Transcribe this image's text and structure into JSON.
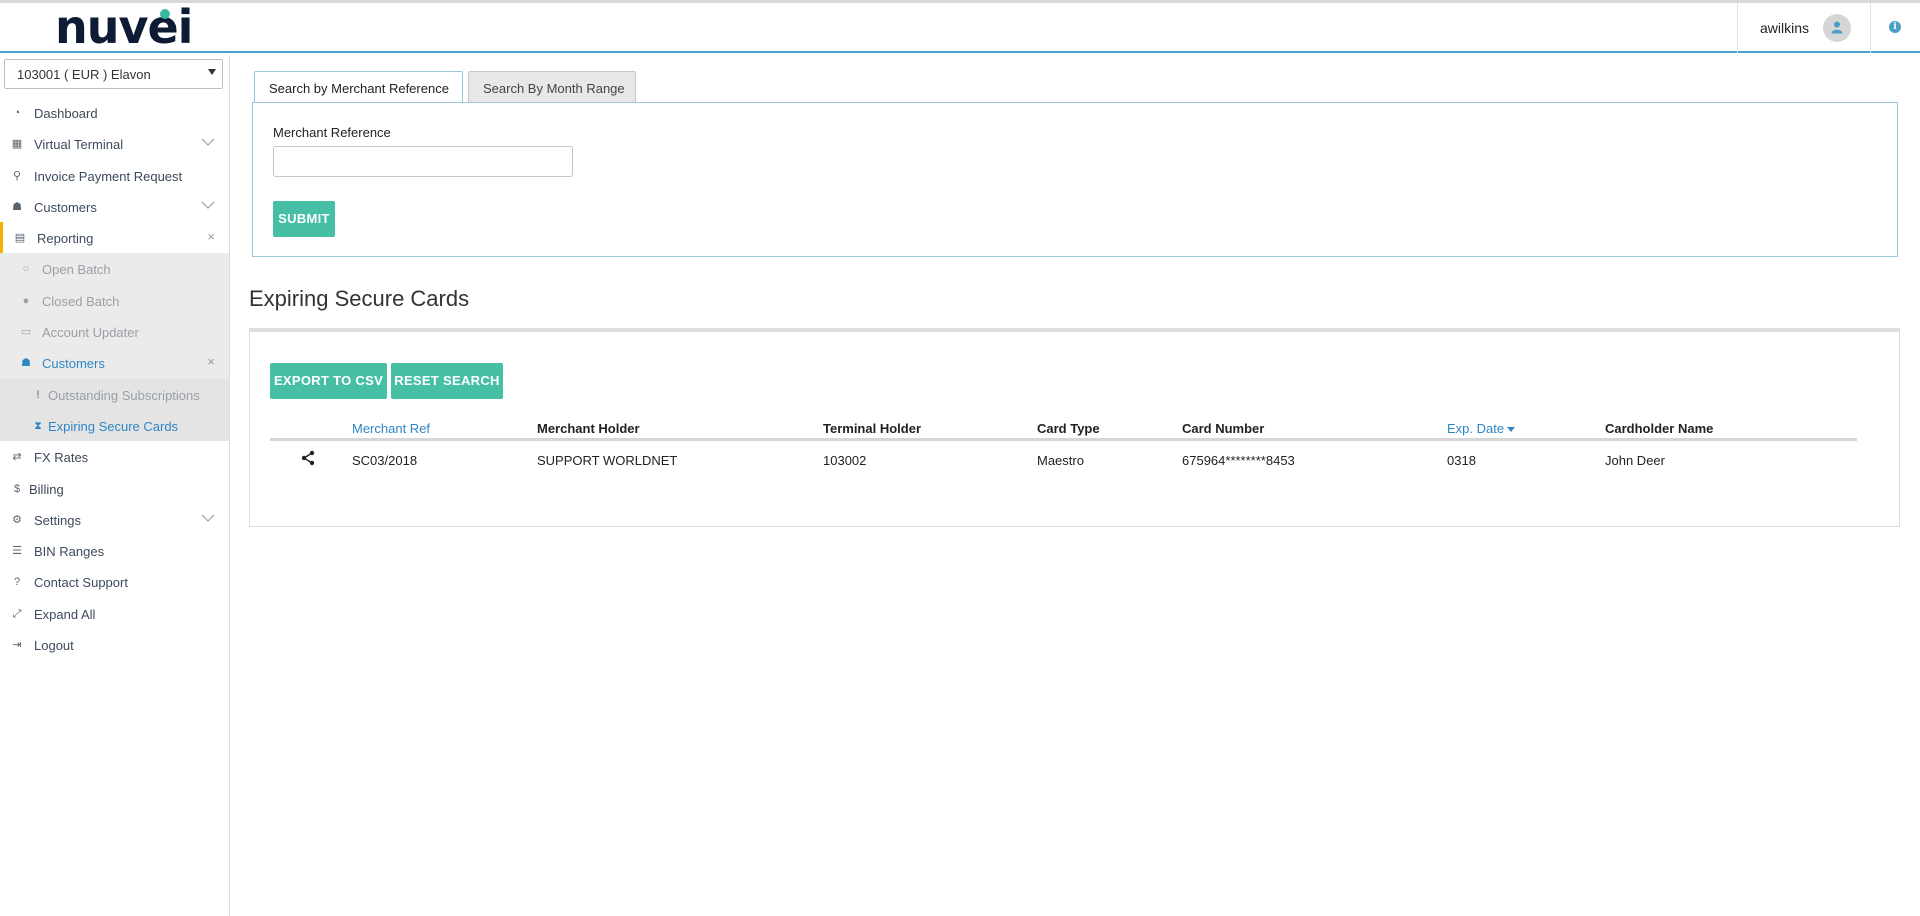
{
  "header": {
    "logo": "nuvei",
    "user_name": "awilkins",
    "icons": {
      "avatar": "user-icon",
      "info": "info-icon"
    },
    "info_glyph": "i"
  },
  "sidebar": {
    "account_select": "103001 ( EUR ) Elavon",
    "items": [
      {
        "label": "Dashboard",
        "icon": "dashboard-icon"
      },
      {
        "label": "Virtual Terminal",
        "icon": "calculator-icon",
        "expandable": true
      },
      {
        "label": "Invoice Payment Request",
        "icon": "link-icon"
      },
      {
        "label": "Customers",
        "icon": "users-icon",
        "expandable": true
      },
      {
        "label": "Reporting",
        "icon": "file-icon",
        "active": true
      },
      {
        "label": "Open Batch",
        "icon": "circle-outline-icon"
      },
      {
        "label": "Closed Batch",
        "icon": "circle-filled-icon"
      },
      {
        "label": "Account Updater",
        "icon": "credit-card-icon"
      },
      {
        "label": "Customers",
        "icon": "users-icon",
        "selected": true
      },
      {
        "label": "Outstanding Subscriptions",
        "icon": "exclamation-icon"
      },
      {
        "label": "Expiring Secure Cards",
        "icon": "hourglass-icon",
        "selected": true
      },
      {
        "label": "FX Rates",
        "icon": "exchange-icon"
      },
      {
        "label": "Billing",
        "icon": "dollar-icon"
      },
      {
        "label": "Settings",
        "icon": "cogs-icon",
        "expandable": true
      },
      {
        "label": "BIN Ranges",
        "icon": "list-icon"
      },
      {
        "label": "Contact Support",
        "icon": "question-icon"
      },
      {
        "label": "Expand All",
        "icon": "expand-icon"
      },
      {
        "label": "Logout",
        "icon": "sign-out-icon"
      }
    ]
  },
  "tabs": [
    {
      "label": "Search by Merchant Reference",
      "active": true
    },
    {
      "label": "Search By Month Range",
      "active": false
    }
  ],
  "search": {
    "field_label": "Merchant Reference",
    "field_value": "",
    "submit_label": "SUBMIT"
  },
  "results": {
    "title": "Expiring Secure Cards",
    "export_label": "EXPORT TO CSV",
    "reset_label": "RESET SEARCH",
    "columns": [
      "Merchant Ref",
      "Merchant Holder",
      "Terminal Holder",
      "Card Type",
      "Card Number",
      "Exp. Date",
      "Cardholder Name"
    ],
    "rows": [
      [
        "SC03/2018",
        "SUPPORT WORLDNET",
        "103002",
        "Maestro",
        "675964********8453",
        "0318",
        "John Deer"
      ]
    ],
    "sorted_column": "Exp. Date",
    "row_action_icon": "share-icon"
  },
  "colors": {
    "accent_teal": "#47bfa5",
    "link_blue": "#2f86c4",
    "active_marker": "#f0b400",
    "logo_navy": "#0e1b35"
  }
}
